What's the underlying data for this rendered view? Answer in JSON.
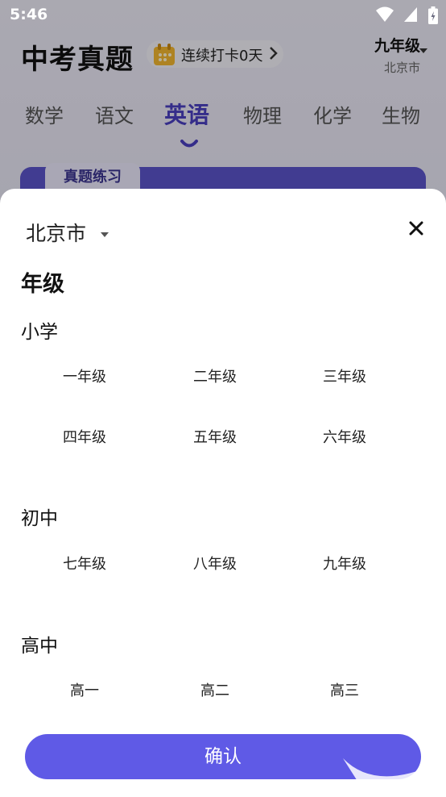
{
  "status_bar": {
    "time": "5:46"
  },
  "background_app": {
    "title": "中考真题",
    "checkin": {
      "label": "连续打卡0天"
    },
    "grade": "九年级",
    "city": "北京市",
    "subjects": [
      "数学",
      "语文",
      "英语",
      "物理",
      "化学",
      "生物"
    ],
    "active_subject": "英语",
    "practice_badge": "真题练习"
  },
  "sheet": {
    "city": "北京市",
    "heading": "年级",
    "sections": [
      {
        "title": "小学",
        "grades": [
          "一年级",
          "二年级",
          "三年级",
          "四年级",
          "五年级",
          "六年级"
        ]
      },
      {
        "title": "初中",
        "grades": [
          "七年级",
          "八年级",
          "九年级"
        ]
      },
      {
        "title": "高中",
        "grades": [
          "高一",
          "高二",
          "高三"
        ]
      }
    ],
    "confirm_label": "确认"
  },
  "colors": {
    "accent": "#5f5ae6",
    "tab_active": "#4a3fbf"
  },
  "icons": [
    "wifi-icon",
    "signal-icon",
    "battery-icon",
    "calendar-icon",
    "chevron-right-icon",
    "dropdown-arrow-icon",
    "close-icon"
  ]
}
